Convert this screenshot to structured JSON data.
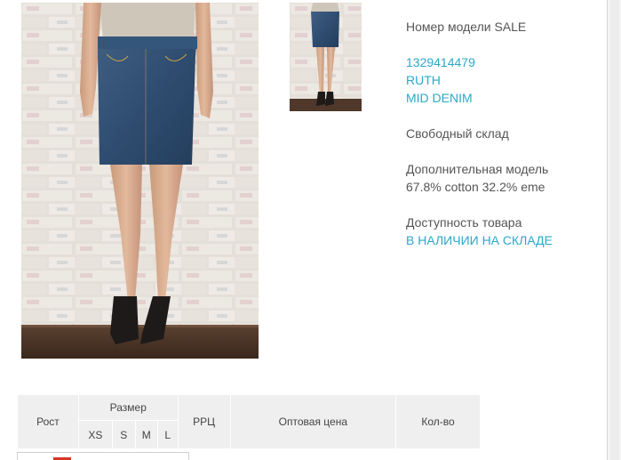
{
  "product": {
    "model_label": "Номер модели SALE",
    "code": "1329414479",
    "name": "RUTH",
    "color": "MID DENIM",
    "warehouse": "Свободный склад",
    "extra_label": "Дополнительная модель",
    "composition": "67.8% cotton 32.2% eme",
    "availability_label": "Доступность товара",
    "availability_value": "В НАЛИЧИИ НА СКЛАДЕ"
  },
  "images": {
    "main": "photo-denim-skirt-front",
    "thumbnail": "photo-denim-skirt-thumbnail"
  },
  "size_table": {
    "headers": {
      "height": "Рост",
      "size": "Размер",
      "price_rrc": "РРЦ",
      "wholesale_price": "Оптовая цена",
      "quantity": "Кол-во"
    },
    "sizes": [
      "XS",
      "S",
      "M",
      "L"
    ]
  },
  "colors": {
    "link": "#2aa8c9",
    "text": "#555555",
    "table_bg": "#efefef"
  }
}
